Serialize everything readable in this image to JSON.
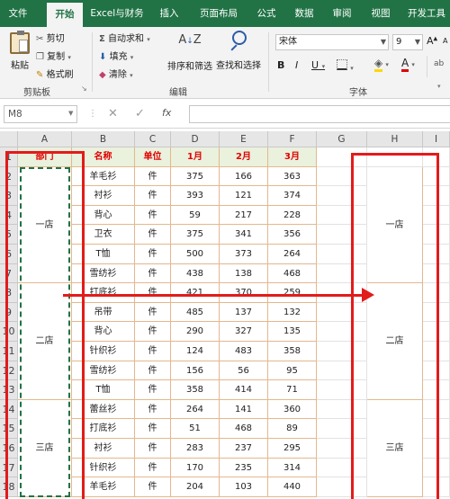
{
  "tabs": [
    "文件",
    "开始",
    "Excel与财务",
    "插入",
    "页面布局",
    "公式",
    "数据",
    "审阅",
    "视图",
    "开发工具"
  ],
  "ribbon": {
    "paste": "粘贴",
    "cut": "剪切",
    "copy": "复制",
    "format_painter": "格式刷",
    "clipboard_group": "剪贴板",
    "autosum": "自动求和",
    "fill": "填充",
    "clear": "清除",
    "sort_filter": "排序和筛选",
    "find_select": "查找和选择",
    "edit_group": "编辑",
    "font_name": "宋体",
    "font_size": "9",
    "font_group": "字体",
    "bold": "B",
    "italic": "I",
    "underline": "U",
    "grow": "A",
    "shrink": "A",
    "wrap": "ab"
  },
  "formula_bar": {
    "name_box": "M8",
    "fx": "fx"
  },
  "columns": [
    "A",
    "B",
    "C",
    "D",
    "E",
    "F",
    "G",
    "H",
    "I"
  ],
  "rows": [
    "1",
    "2",
    "3",
    "4",
    "5",
    "6",
    "7",
    "8",
    "9",
    "10",
    "11",
    "12",
    "13",
    "14",
    "15",
    "16",
    "17",
    "18"
  ],
  "headers": [
    "部门",
    "名称",
    "单位",
    "1月",
    "2月",
    "3月"
  ],
  "data": [
    [
      "羊毛衫",
      "件",
      "375",
      "166",
      "363"
    ],
    [
      "衬衫",
      "件",
      "393",
      "121",
      "374"
    ],
    [
      "背心",
      "件",
      "59",
      "217",
      "228"
    ],
    [
      "卫衣",
      "件",
      "375",
      "341",
      "356"
    ],
    [
      "T恤",
      "件",
      "500",
      "373",
      "264"
    ],
    [
      "雪纺衫",
      "件",
      "438",
      "138",
      "468"
    ],
    [
      "打底衫",
      "件",
      "421",
      "370",
      "259"
    ],
    [
      "吊带",
      "件",
      "485",
      "137",
      "132"
    ],
    [
      "背心",
      "件",
      "290",
      "327",
      "135"
    ],
    [
      "针织衫",
      "件",
      "124",
      "483",
      "358"
    ],
    [
      "雪纺衫",
      "件",
      "156",
      "56",
      "95"
    ],
    [
      "T恤",
      "件",
      "358",
      "414",
      "71"
    ],
    [
      "蕾丝衫",
      "件",
      "264",
      "141",
      "360"
    ],
    [
      "打底衫",
      "件",
      "51",
      "468",
      "89"
    ],
    [
      "衬衫",
      "件",
      "283",
      "237",
      "295"
    ],
    [
      "针织衫",
      "件",
      "170",
      "235",
      "314"
    ],
    [
      "羊毛衫",
      "件",
      "204",
      "103",
      "440"
    ]
  ],
  "departments": [
    "一店",
    "二店",
    "三店"
  ],
  "h_column": [
    "一店",
    "二店",
    "三店"
  ]
}
